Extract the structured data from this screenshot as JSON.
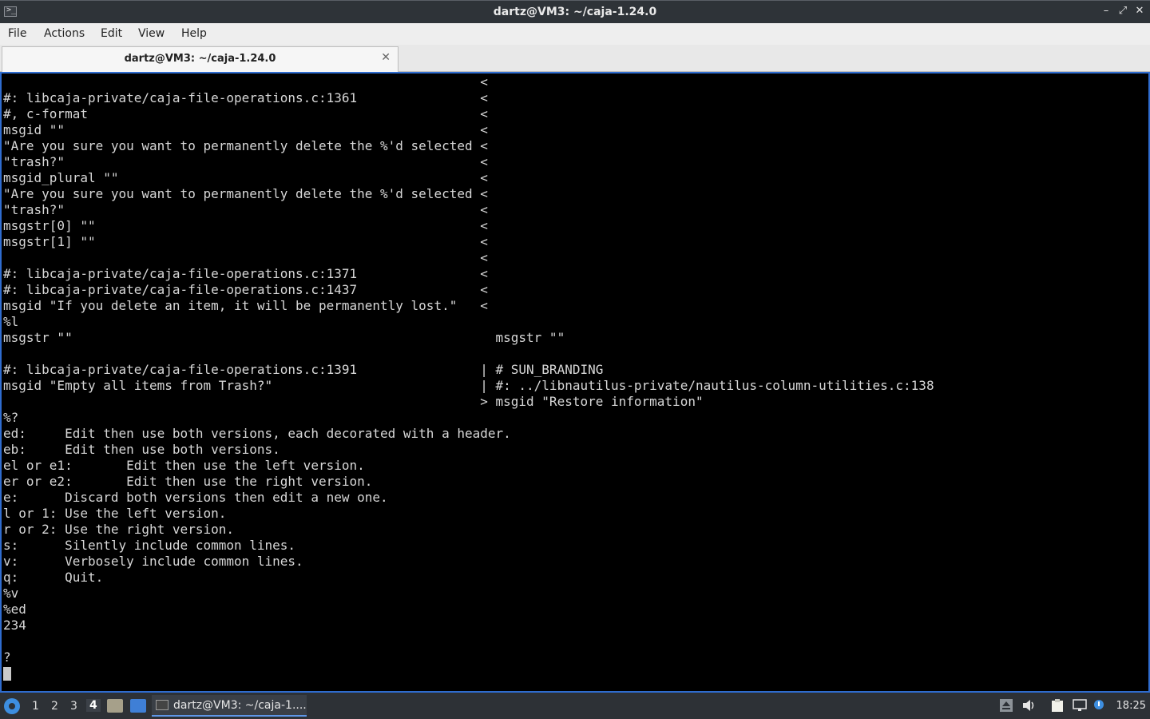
{
  "window": {
    "title": "dartz@VM3: ~/caja-1.24.0",
    "minimize_glyph": "–",
    "maximize_glyph": "⤢",
    "close_glyph": "✕"
  },
  "menu": [
    "File",
    "Actions",
    "Edit",
    "View",
    "Help"
  ],
  "tab": {
    "label": "dartz@VM3: ~/caja-1.24.0",
    "close_glyph": "✕"
  },
  "terminal": {
    "lines": [
      "                                                              <",
      "#: libcaja-private/caja-file-operations.c:1361                <",
      "#, c-format                                                   <",
      "msgid \"\"                                                      <",
      "\"Are you sure you want to permanently delete the %'d selected <",
      "\"trash?\"                                                      <",
      "msgid_plural \"\"                                               <",
      "\"Are you sure you want to permanently delete the %'d selected <",
      "\"trash?\"                                                      <",
      "msgstr[0] \"\"                                                  <",
      "msgstr[1] \"\"                                                  <",
      "                                                              <",
      "#: libcaja-private/caja-file-operations.c:1371                <",
      "#: libcaja-private/caja-file-operations.c:1437                <",
      "msgid \"If you delete an item, it will be permanently lost.\"   <",
      "%l",
      "msgstr \"\"                                                       msgstr \"\"",
      "",
      "#: libcaja-private/caja-file-operations.c:1391                | # SUN_BRANDING",
      "msgid \"Empty all items from Trash?\"                           | #: ../libnautilus-private/nautilus-column-utilities.c:138",
      "                                                              > msgid \"Restore information\"",
      "%?",
      "ed:     Edit then use both versions, each decorated with a header.",
      "eb:     Edit then use both versions.",
      "el or e1:       Edit then use the left version.",
      "er or e2:       Edit then use the right version.",
      "e:      Discard both versions then edit a new one.",
      "l or 1: Use the left version.",
      "r or 2: Use the right version.",
      "s:      Silently include common lines.",
      "v:      Verbosely include common lines.",
      "q:      Quit.",
      "%v",
      "%ed",
      "234",
      "",
      "?"
    ]
  },
  "taskbar": {
    "workspaces": [
      "1",
      "2",
      "3",
      "4"
    ],
    "active_workspace": "4",
    "task_label": "dartz@VM3: ~/caja-1....",
    "clock": "18:25",
    "tray_icons": [
      "eject-icon",
      "volume-icon",
      "clipboard-icon",
      "network-icon",
      "update-icon"
    ]
  },
  "colors": {
    "terminal_bg": "#000000",
    "terminal_fg": "#d7d7d7",
    "focus_border": "#2f6ccf",
    "panel_bg": "#2d3136"
  }
}
